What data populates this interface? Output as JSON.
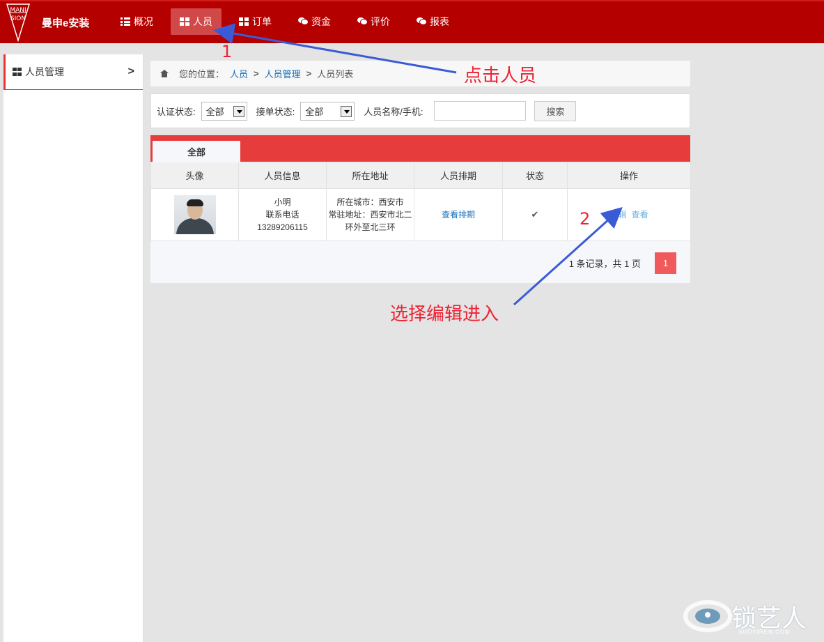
{
  "header": {
    "brand": "曼申e安装",
    "logo_text_top": "MANI",
    "logo_text_bottom": "SION",
    "nav": [
      {
        "label": "概况",
        "icon": "list-icon"
      },
      {
        "label": "人员",
        "icon": "grid-icon",
        "active": true
      },
      {
        "label": "订单",
        "icon": "grid-icon"
      },
      {
        "label": "资金",
        "icon": "chat-icon"
      },
      {
        "label": "评价",
        "icon": "chat-icon"
      },
      {
        "label": "报表",
        "icon": "chat-icon"
      }
    ]
  },
  "sidebar": {
    "items": [
      {
        "label": "人员管理",
        "icon": "grid-icon"
      }
    ]
  },
  "breadcrumb": {
    "prefix": "您的位置：",
    "items": [
      "人员",
      "人员管理"
    ],
    "current": "人员列表"
  },
  "filter": {
    "cert_label": "认证状态:",
    "cert_value": "全部",
    "order_label": "接单状态:",
    "order_value": "全部",
    "name_label": "人员名称/手机:",
    "name_value": "",
    "search_button": "搜索"
  },
  "table": {
    "tab": "全部",
    "headers": [
      "头像",
      "人员信息",
      "所在地址",
      "人员排期",
      "状态",
      "操作"
    ],
    "rows": [
      {
        "name": "小明",
        "phone_label": "联系电话",
        "phone": "13289206115",
        "city": "所在城市：西安市",
        "address": "常驻地址：西安市北二环外至北三环",
        "schedule": "查看排期",
        "status": "✔",
        "edit": "编辑",
        "view": "查看"
      }
    ],
    "pager_info": "1 条记录，共 1 页",
    "page": "1"
  },
  "annotations": {
    "n1": "1",
    "a1": "点击人员",
    "n2": "2",
    "a2": "选择编辑进入"
  },
  "watermark": {
    "text": "锁艺人",
    "sub": "SUOYIREN.COM"
  },
  "colors": {
    "header_bg": "#b50000",
    "tab_bar": "#e63c3c",
    "pager": "#f05a5a",
    "annotation": "#e22233",
    "arrow": "#3b5bd6"
  }
}
